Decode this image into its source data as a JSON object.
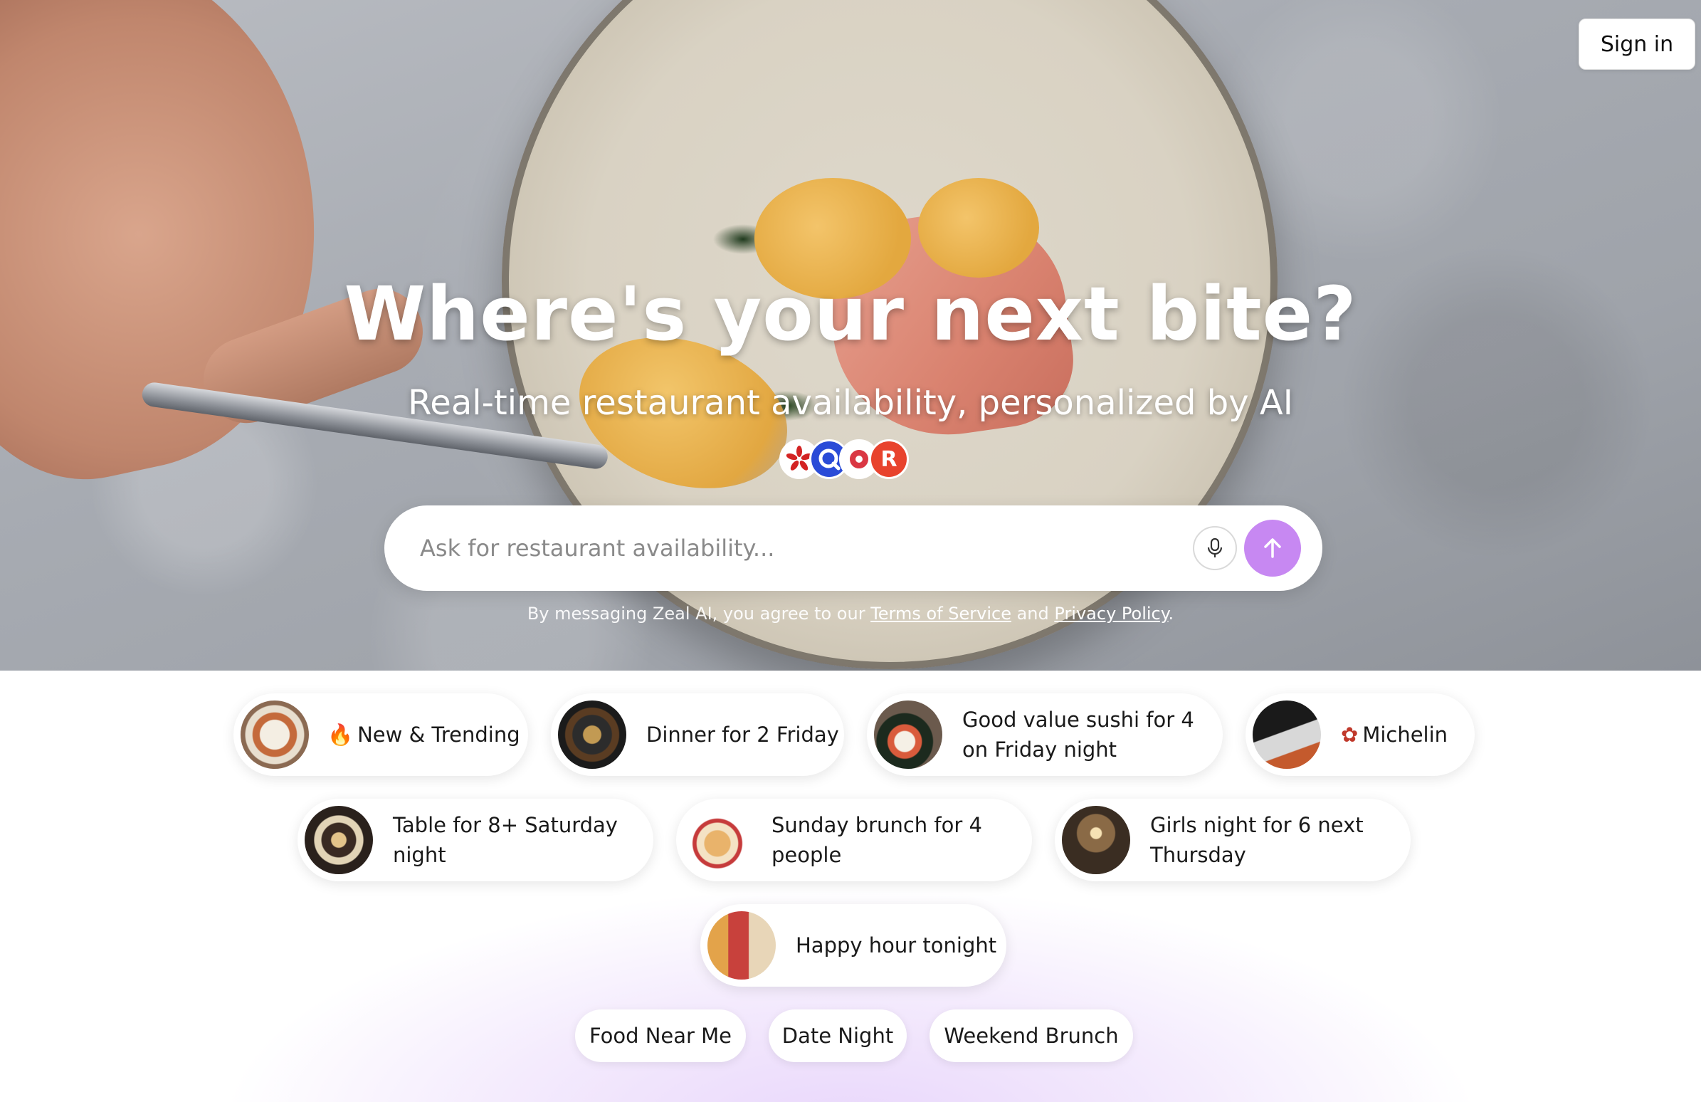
{
  "header": {
    "signin_label": "Sign in"
  },
  "hero": {
    "title": "Where's your next bite?",
    "subtitle": "Real-time restaurant availability, personalized by AI",
    "partner_logos": [
      "yelp-logo-icon",
      "opentable-q-logo-icon",
      "opentable-logo-icon",
      "resy-logo-icon"
    ],
    "resy_letter": "R"
  },
  "search": {
    "placeholder": "Ask for restaurant availability...",
    "value": ""
  },
  "disclaimer": {
    "prefix": "By messaging Zeal AI, you agree to our ",
    "terms_label": "Terms of Service",
    "middle": " and ",
    "privacy_label": "Privacy Policy",
    "suffix": "."
  },
  "suggestions": [
    {
      "label": "New & Trending",
      "icon": "fire-icon",
      "icon_glyph": "🔥"
    },
    {
      "label": "Dinner for 2 Friday"
    },
    {
      "label": "Good value sushi for 4 on Friday night"
    },
    {
      "label": "Michelin",
      "icon": "michelin-flower-icon",
      "icon_glyph": "✿"
    },
    {
      "label": "Table for 8+ Saturday night"
    },
    {
      "label": "Sunday brunch for 4 people"
    },
    {
      "label": "Girls night for 6 next Thursday"
    },
    {
      "label": "Happy hour tonight"
    }
  ],
  "quick_filters": [
    "Food Near Me",
    "Date Night",
    "Weekend Brunch"
  ],
  "colors": {
    "send_button": "#c788f2",
    "lower_gradient": "#e9d7fb",
    "michelin": "#c0392b"
  }
}
